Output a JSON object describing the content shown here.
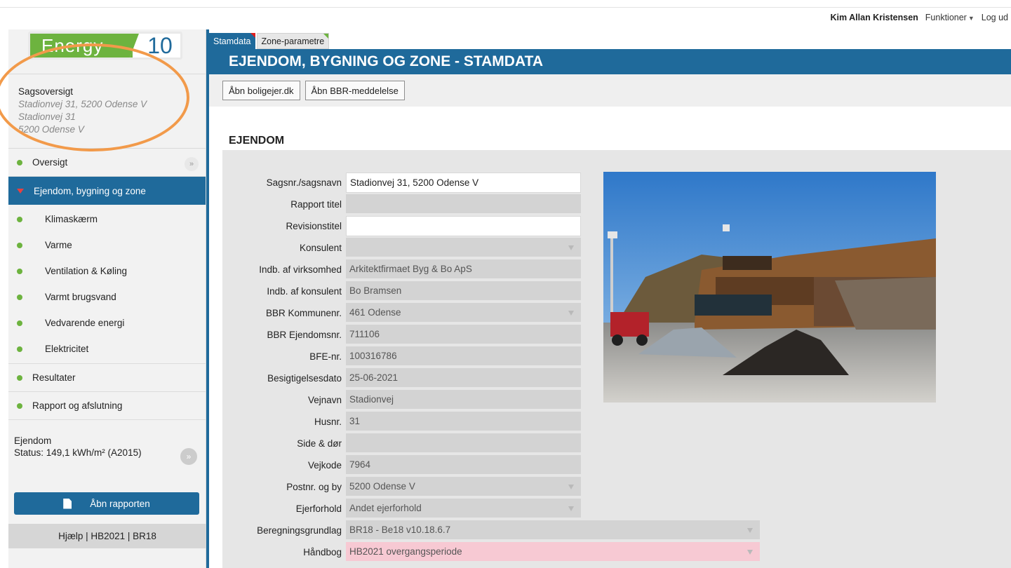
{
  "header": {
    "user_name": "Kim Allan Kristensen",
    "functions_label": "Funktioner",
    "logout_label": "Log ud"
  },
  "logo": {
    "text": "Energy",
    "number": "10"
  },
  "case": {
    "title": "Sagsoversigt",
    "line1": "Stadionvej 31, 5200 Odense V",
    "line2": "Stadionvej 31",
    "line3": "5200 Odense V"
  },
  "nav": {
    "overview": "Oversigt",
    "property": "Ejendom, bygning og zone",
    "sub": [
      "Klimaskærm",
      "Varme",
      "Ventilation & Køling",
      "Varmt brugsvand",
      "Vedvarende energi",
      "Elektricitet"
    ],
    "results": "Resultater",
    "report": "Rapport og afslutning"
  },
  "status": {
    "title": "Ejendom",
    "value": "Status: 149,1 kWh/m² (A2015)"
  },
  "sidebar_footer": {
    "open_report": "Åbn rapporten",
    "help": "Hjælp | HB2021 | BR18"
  },
  "tabs": [
    {
      "label": "Stamdata",
      "active": true
    },
    {
      "label": "Zone-parametre",
      "active": false
    }
  ],
  "page_title": "EJENDOM, BYGNING OG ZONE - STAMDATA",
  "actions": {
    "open_boligejer": "Åbn boligejer.dk",
    "open_bbr": "Åbn BBR-meddelelse"
  },
  "section_title": "EJENDOM",
  "form": {
    "sagsnr": {
      "label": "Sagsnr./sagsnavn",
      "value": "Stadionvej 31, 5200 Odense V"
    },
    "rapport_titel": {
      "label": "Rapport titel",
      "value": ""
    },
    "revisionstitel": {
      "label": "Revisionstitel",
      "value": ""
    },
    "konsulent": {
      "label": "Konsulent",
      "value": ""
    },
    "virksomhed": {
      "label": "Indb. af virksomhed",
      "value": "Arkitektfirmaet Byg & Bo ApS"
    },
    "indb_konsulent": {
      "label": "Indb. af konsulent",
      "value": "Bo Bramsen"
    },
    "kommunenr": {
      "label": "BBR Kommunenr.",
      "value": "461 Odense"
    },
    "ejendomsnr": {
      "label": "BBR Ejendomsnr.",
      "value": "711106"
    },
    "bfe": {
      "label": "BFE-nr.",
      "value": "100316786"
    },
    "besigtigelse": {
      "label": "Besigtigelsesdato",
      "value": "25-06-2021"
    },
    "vejnavn": {
      "label": "Vejnavn",
      "value": "Stadionvej"
    },
    "husnr": {
      "label": "Husnr.",
      "value": "31"
    },
    "side_doer": {
      "label": "Side & dør",
      "value": ""
    },
    "vejkode": {
      "label": "Vejkode",
      "value": "7964"
    },
    "postnr": {
      "label": "Postnr. og by",
      "value": "5200 Odense V"
    },
    "ejerforhold": {
      "label": "Ejerforhold",
      "value": "Andet ejerforhold"
    },
    "beregning": {
      "label": "Beregningsgrundlag",
      "value": "BR18 - Be18 v10.18.6.7"
    },
    "haandbog": {
      "label": "Håndbog",
      "value": "HB2021 overgangsperiode"
    }
  },
  "colors": {
    "primary": "#1f6a9b",
    "green": "#6db33f",
    "annotation": "#f29a4a",
    "pink_field": "#f7c9d3"
  }
}
